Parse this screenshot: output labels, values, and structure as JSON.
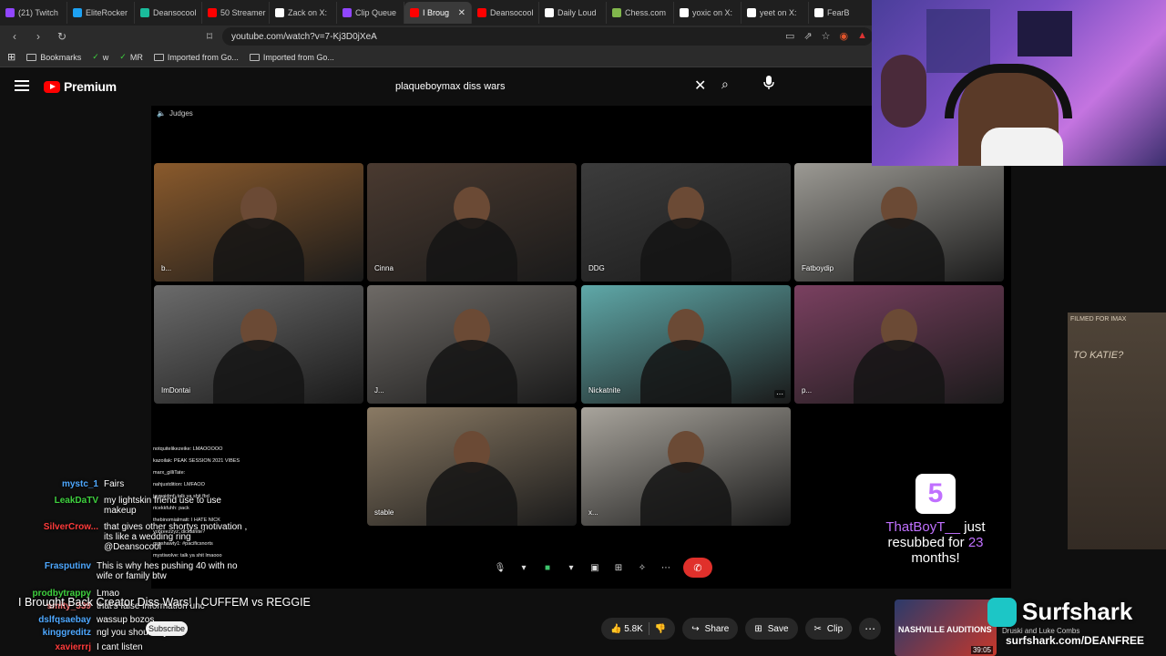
{
  "browser": {
    "tabs": [
      {
        "label": "(21) Twitch",
        "color": "#9146ff",
        "active": false
      },
      {
        "label": "EliteRocker",
        "color": "#1da1f2",
        "active": false
      },
      {
        "label": "Deansocool",
        "color": "#1abc9c",
        "active": false
      },
      {
        "label": "50 Streamer",
        "color": "#ff0000",
        "active": false
      },
      {
        "label": "Zack on X:",
        "color": "#ffffff",
        "active": false
      },
      {
        "label": "Clip Queue",
        "color": "#9146ff",
        "active": false
      },
      {
        "label": "I Broug",
        "color": "#ff0000",
        "active": true
      },
      {
        "label": "Deansocool",
        "color": "#ff0000",
        "active": false
      },
      {
        "label": "Daily Loud",
        "color": "#ffffff",
        "active": false
      },
      {
        "label": "Chess.com",
        "color": "#81b64c",
        "active": false
      },
      {
        "label": "yoxic on X:",
        "color": "#ffffff",
        "active": false
      },
      {
        "label": "yeet on X:",
        "color": "#ffffff",
        "active": false
      },
      {
        "label": "FearB",
        "color": "#ffffff",
        "active": false
      }
    ],
    "url": "youtube.com/watch?v=7-Kj3D0jXeA",
    "bookmarks": [
      {
        "label": "Bookmarks",
        "type": "folder"
      },
      {
        "label": "w",
        "type": "link"
      },
      {
        "label": "MR",
        "type": "link"
      },
      {
        "label": "Imported from Go...",
        "type": "folder"
      },
      {
        "label": "Imported from Go...",
        "type": "folder"
      }
    ]
  },
  "youtube": {
    "logo_text": "Premium",
    "search_value": "plaqueboymax diss wars",
    "video": {
      "header_label": "Judges",
      "participants": [
        {
          "name": "b...",
          "bg": "#8a5a2c"
        },
        {
          "name": "Cinna",
          "bg": "#4a3a30"
        },
        {
          "name": "DDG",
          "bg": "#3c3c3c"
        },
        {
          "name": "Fatboydip",
          "bg": "#9c9a94"
        },
        {
          "name": "ImDontai",
          "bg": "#6b6b6b"
        },
        {
          "name": "J...",
          "bg": "#6e6a66"
        },
        {
          "name": "Nickatnite",
          "bg": "#5fa8a8"
        },
        {
          "name": "p...",
          "bg": "#7a4060"
        },
        {
          "name": "stable",
          "bg": "#8a7a64"
        },
        {
          "name": "x...",
          "bg": "#a8a49c"
        }
      ],
      "participants_more": "⋯"
    },
    "title": "I Brought Back Creator Diss Wars! | CUFFEM vs REGGIE",
    "subscribe_label": "Subscribe",
    "actions": {
      "likes": "5.8K",
      "share": "Share",
      "save": "Save",
      "clip": "Clip",
      "more": "⋯"
    }
  },
  "chat": {
    "messages": [
      {
        "user": "mystc_1",
        "user_color": "#4ea8ff",
        "text": "Fairs"
      },
      {
        "user": "LeakDaTV",
        "user_color": "#3ed13e",
        "text": "my lightskin friend use to use makeup"
      },
      {
        "user": "SilverCrow...",
        "user_color": "#ff3b3b",
        "text": "that gives other shortys motivation , its like a wedding ring @Deansocool"
      },
      {
        "user": "Frasputinv",
        "user_color": "#4ea8ff",
        "text": "This is why hes pushing 40 with no wife or family btw"
      },
      {
        "user": "prodbytrappy",
        "user_color": "#3ed13e",
        "text": "Lmao"
      },
      {
        "user": "smity_339",
        "user_color": "#ff7a7a",
        "text": "that's false information unc"
      },
      {
        "user": "dslfqsaebay",
        "user_color": "#4ea8ff",
        "text": "wassup bozos"
      },
      {
        "user": "kinggreditz",
        "user_color": "#4ea8ff",
        "text": "ngl you should try one"
      },
      {
        "user": "xavierrrj",
        "user_color": "#ff3b3b",
        "text": "I cant listen"
      }
    ],
    "inner_chat": [
      "notquitelikezeike: LMAOOOOO",
      "kazoilak: PEAK SESSION 2021 VIBES",
      "marx_gilliTate:",
      "nahjustdition: LMFAOO",
      "jaypaidmf: talk ya shit fbd",
      "ricekkfuhh: pack",
      "thebinomialmatt: I HATE NICK",
      "yobreezzyz: dickatnite?",
      "gspshawty1: #pacificsnorts",
      "mystiwolve: talk ya shit lmaooo"
    ]
  },
  "overlays": {
    "resub_user": "ThatBoyT__",
    "resub_text": " just resubbed for ",
    "resub_months": "23",
    "resub_suffix": " months!",
    "resub_badge": "5",
    "sponsor_name": "Surfshark",
    "sponsor_url": "surfshark.com/DEANFREE",
    "poster_label": "FILMED FOR IMAX",
    "poster_text": "TO KATIE?",
    "next_video_time": "39:05",
    "next_video_label": "NASHVILLE AUDITIONS",
    "next_video_meta": "Druski and Luke Combs"
  },
  "colors": {
    "accent_red": "#ff0000",
    "end_call_red": "#e0302b",
    "resub_purple": "#c070ff"
  }
}
